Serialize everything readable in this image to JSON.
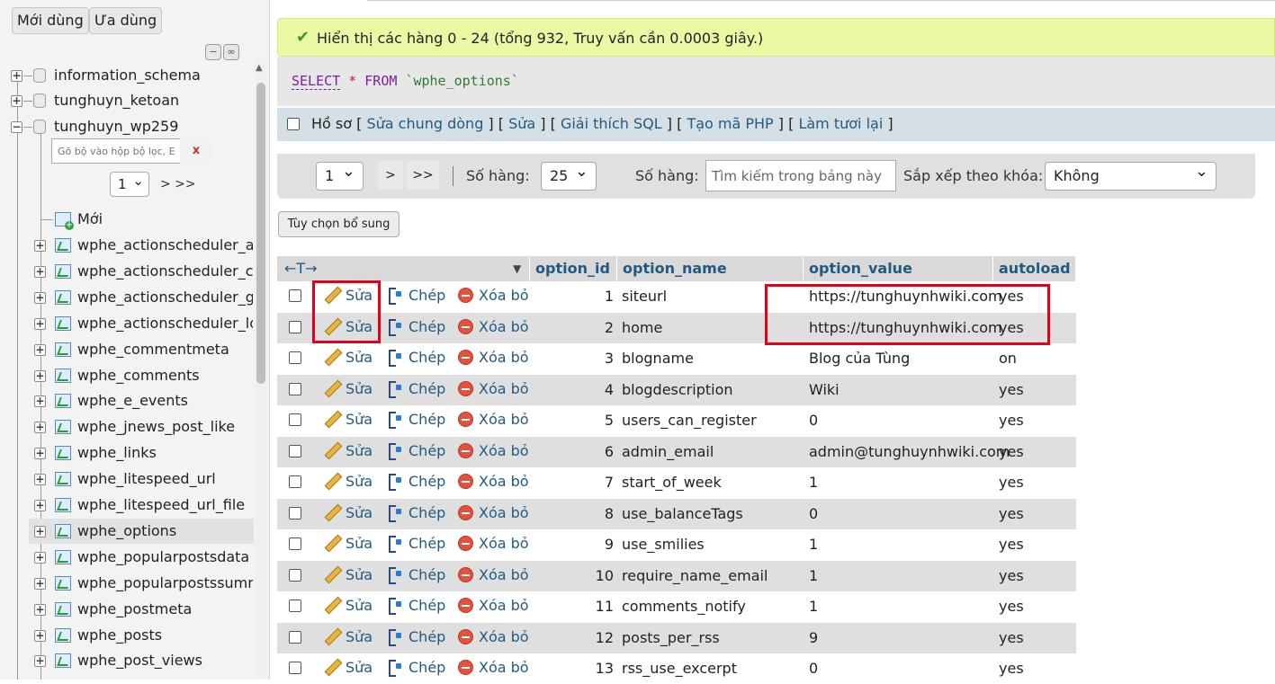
{
  "nav": {
    "btn_recent": "Mới dùng",
    "btn_favorites": "Ưa dùng",
    "databases": [
      "information_schema",
      "tunghuyn_ketoan",
      "tunghuyn_wp259"
    ],
    "filter_placeholder": "Gõ bộ vào hộp bộ lọc, Ent",
    "filter_clear": "x",
    "page_value": "1",
    "page_next": "> >>",
    "new_label": "Mới",
    "tables": [
      "wphe_actionscheduler_actions",
      "wphe_actionscheduler_claims",
      "wphe_actionscheduler_groups",
      "wphe_actionscheduler_logs",
      "wphe_commentmeta",
      "wphe_comments",
      "wphe_e_events",
      "wphe_jnews_post_like",
      "wphe_links",
      "wphe_litespeed_url",
      "wphe_litespeed_url_file",
      "wphe_options",
      "wphe_popularpostsdata",
      "wphe_popularpostssummary",
      "wphe_postmeta",
      "wphe_posts",
      "wphe_post_views"
    ],
    "active_table": "wphe_options"
  },
  "success_message": "Hiển thị các hàng 0 - 24 (tổng 932, Truy vấn cần 0.0003 giây.)",
  "sql": {
    "select": "SELECT",
    "star": "*",
    "from": "FROM",
    "table": "`wphe_options`"
  },
  "profile": {
    "label": "Hồ sơ",
    "links": [
      "Sửa chung dòng",
      "Sửa",
      "Giải thích SQL",
      "Tạo mã PHP",
      "Làm tươi lại"
    ]
  },
  "pager": {
    "page": "1",
    "next": ">",
    "last": ">>",
    "rows_label": "Số hàng:",
    "rows_value": "25",
    "filter_label": "Số hàng:",
    "search_placeholder": "Tìm kiếm trong bảng này",
    "sort_label": "Sắp xếp theo khóa:",
    "sort_value": "Không"
  },
  "extra_options": "Tùy chọn bổ sung",
  "table": {
    "arrows": "←T→",
    "columns": [
      "option_id",
      "option_name",
      "option_value",
      "autoload"
    ],
    "actions": {
      "edit": "Sửa",
      "copy": "Chép",
      "delete": "Xóa bỏ"
    },
    "rows": [
      {
        "id": "1",
        "name": "siteurl",
        "value": "https://tunghuynhwiki.com",
        "autoload": "yes"
      },
      {
        "id": "2",
        "name": "home",
        "value": "https://tunghuynhwiki.com",
        "autoload": "yes"
      },
      {
        "id": "3",
        "name": "blogname",
        "value": "Blog của Tùng",
        "autoload": "on"
      },
      {
        "id": "4",
        "name": "blogdescription",
        "value": "Wiki",
        "autoload": "yes"
      },
      {
        "id": "5",
        "name": "users_can_register",
        "value": "0",
        "autoload": "yes"
      },
      {
        "id": "6",
        "name": "admin_email",
        "value": "admin@tunghuynhwiki.com",
        "autoload": "yes"
      },
      {
        "id": "7",
        "name": "start_of_week",
        "value": "1",
        "autoload": "yes"
      },
      {
        "id": "8",
        "name": "use_balanceTags",
        "value": "0",
        "autoload": "yes"
      },
      {
        "id": "9",
        "name": "use_smilies",
        "value": "1",
        "autoload": "yes"
      },
      {
        "id": "10",
        "name": "require_name_email",
        "value": "1",
        "autoload": "yes"
      },
      {
        "id": "11",
        "name": "comments_notify",
        "value": "1",
        "autoload": "yes"
      },
      {
        "id": "12",
        "name": "posts_per_rss",
        "value": "9",
        "autoload": "yes"
      },
      {
        "id": "13",
        "name": "rss_use_excerpt",
        "value": "0",
        "autoload": "yes"
      }
    ]
  },
  "colors": {
    "link": "#235a81",
    "highlight_box": "#e3001b",
    "success_bg": "#ebf8a4"
  }
}
